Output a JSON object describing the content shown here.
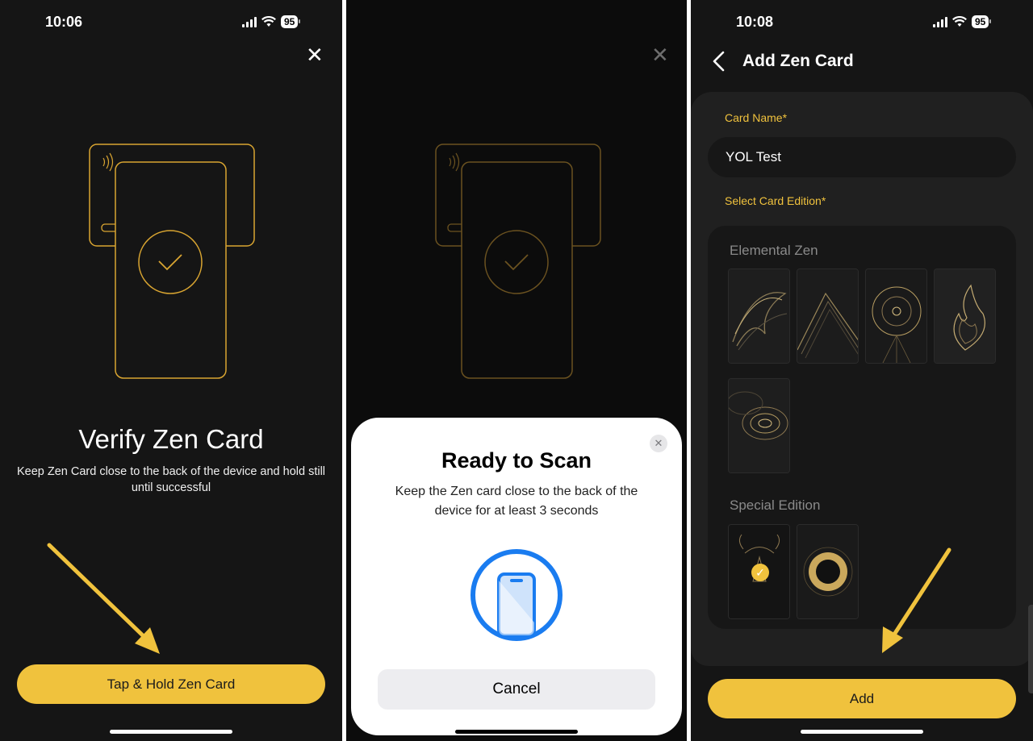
{
  "screen1": {
    "status": {
      "time": "10:06",
      "battery": "95"
    },
    "close_icon": "close-icon",
    "title": "Verify Zen Card",
    "description": "Keep Zen Card close to the back of the device and hold still until successful",
    "button_label": "Tap & Hold Zen Card"
  },
  "screen2": {
    "sheet": {
      "title": "Ready to Scan",
      "description": "Keep the Zen card close to the back of the device for at least 3 seconds",
      "cancel_label": "Cancel"
    }
  },
  "screen3": {
    "status": {
      "time": "10:08",
      "battery": "95"
    },
    "header": {
      "title": "Add Zen Card"
    },
    "card_name_label": "Card Name*",
    "card_name_value": "YOL Test",
    "edition_label": "Select Card Edition*",
    "groups": [
      {
        "title": "Elemental Zen",
        "cards": [
          "air",
          "earth",
          "ether",
          "fire",
          "water"
        ]
      },
      {
        "title": "Special Edition",
        "cards": [
          "year-of-love",
          "the-one"
        ],
        "selected": "year-of-love"
      }
    ],
    "add_label": "Add"
  },
  "colors": {
    "accent": "#f0c23d",
    "background": "#151515",
    "ios_blue": "#1a7cf0"
  }
}
